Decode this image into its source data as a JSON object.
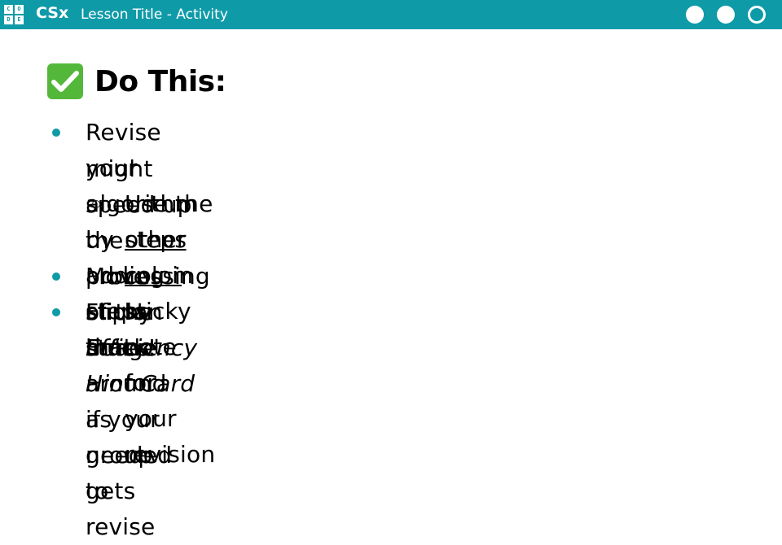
{
  "header": {
    "logo_letters": [
      "C",
      "O",
      "D",
      "E"
    ],
    "brand": "CSx",
    "lesson_title": "Lesson Title - Activity",
    "progress_dots": [
      {
        "name": "progress-dot-1",
        "state": "filled"
      },
      {
        "name": "progress-dot-2",
        "state": "filled"
      },
      {
        "name": "progress-dot-3",
        "state": "empty"
      }
    ]
  },
  "heading": {
    "icon": "check-mark-icon",
    "text": "Do This:"
  },
  "items": [
    {
      "line1": "Revise your algorithm by adding in steps that",
      "line2": "might speed up the processing of the image"
    },
    {
      "pre": "Use the ",
      "underlined": "other color",
      "post": " sticky note for your revision",
      "line2": "steps"
    },
    {
      "line1": "Move sticky notes around as needed to revise"
    },
    {
      "pre": "Flip an ",
      "italic": "Efficiency Hint Card",
      "post": " if your group gets",
      "line2": "stuck!"
    }
  ],
  "colors": {
    "accent": "#0f9aa8",
    "check_green": "#53b83a"
  }
}
